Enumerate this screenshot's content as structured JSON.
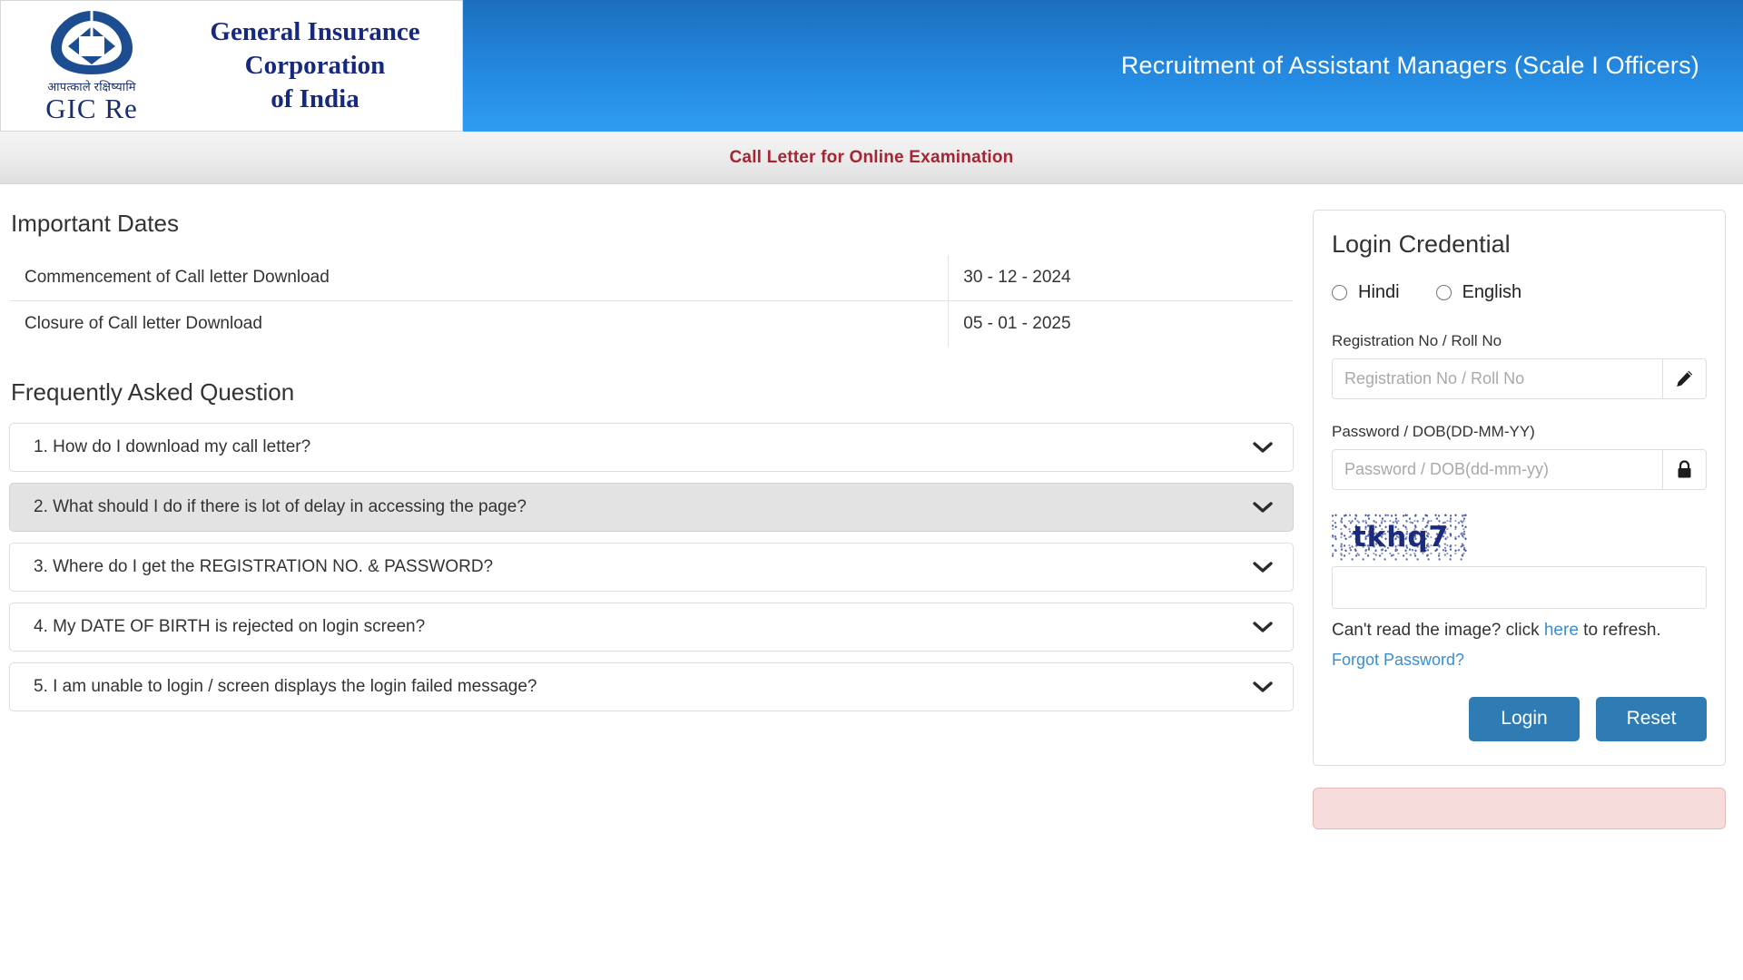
{
  "header": {
    "logo": {
      "hindi_motto": "आपत्काले रक्षिष्यामि",
      "abbrev": "GIC Re",
      "line1": "General Insurance",
      "line2": "Corporation",
      "line3": "of India",
      "icon": "gic-re-logo-icon"
    },
    "title": "Recruitment of Assistant Managers (Scale I Officers)",
    "gradient_top": "#1b6fbd",
    "gradient_bottom": "#2e9cf2"
  },
  "subheader": {
    "text": "Call Letter for Online Examination",
    "color": "#a52532"
  },
  "important_dates": {
    "heading": "Important Dates",
    "rows": [
      {
        "label": "Commencement of Call letter Download",
        "value": "30 - 12 - 2024"
      },
      {
        "label": "Closure of Call letter Download",
        "value": "05 - 01 - 2025"
      }
    ]
  },
  "faq": {
    "heading": "Frequently Asked Question",
    "items": [
      {
        "text": "1. How do I download my call letter?",
        "active": false
      },
      {
        "text": "2. What should I do if there is lot of delay in accessing the page?",
        "active": true
      },
      {
        "text": "3. Where do I get the REGISTRATION NO. & PASSWORD?",
        "active": false
      },
      {
        "text": "4. My DATE OF BIRTH is rejected on login screen?",
        "active": false
      },
      {
        "text": "5. I am unable to login / screen displays the login failed message?",
        "active": false
      }
    ]
  },
  "login": {
    "title": "Login Credential",
    "language_options": [
      {
        "label": "Hindi",
        "selected": false
      },
      {
        "label": "English",
        "selected": false
      }
    ],
    "registration": {
      "label": "Registration No / Roll No",
      "placeholder": "Registration No / Roll No",
      "value": "",
      "icon": "pencil-icon"
    },
    "password": {
      "label": "Password / DOB(DD-MM-YY)",
      "placeholder": "Password / DOB(dd-mm-yy)",
      "value": "",
      "icon": "lock-icon"
    },
    "captcha": {
      "text": "tkhq7",
      "input_value": "",
      "input_placeholder": "",
      "refresh_prefix": "Can't read the image? click ",
      "refresh_link": "here",
      "refresh_suffix": " to refresh."
    },
    "forgot_password": "Forgot Password?",
    "buttons": {
      "login": "Login",
      "reset": "Reset"
    },
    "button_color": "#2f7cb5",
    "link_color": "#3a8dd1"
  },
  "alert": {
    "text": "",
    "background": "#f7dcdc",
    "border": "#e8b7b7"
  }
}
